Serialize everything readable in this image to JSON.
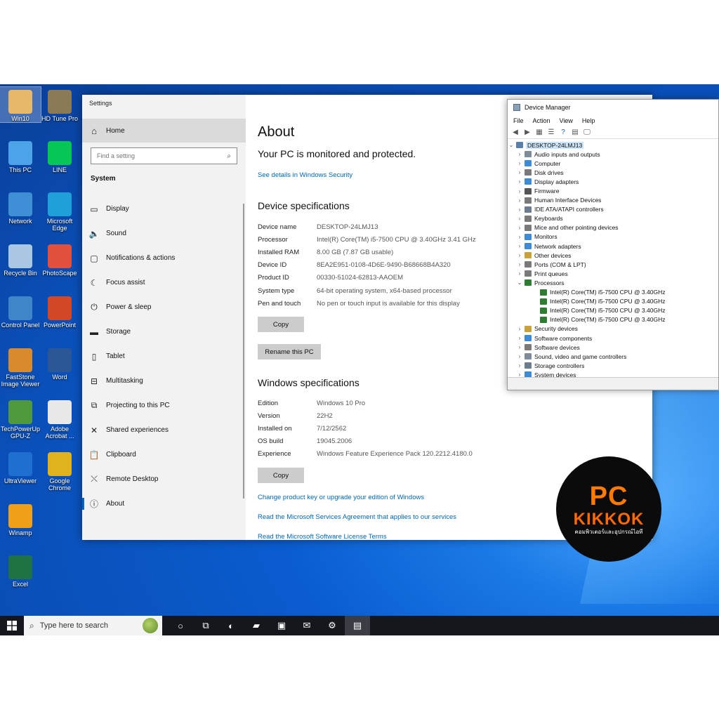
{
  "desktop_icons": [
    {
      "label": "Win10",
      "icon": "user-folder-icon",
      "color": "#e7b86a"
    },
    {
      "label": "HD Tune Pro",
      "icon": "hd-tune-icon",
      "color": "#8a7a55"
    },
    {
      "label": "This PC",
      "icon": "this-pc-icon",
      "color": "#4da3e8"
    },
    {
      "label": "LINE",
      "icon": "line-app-icon",
      "color": "#06c755"
    },
    {
      "label": "Network",
      "icon": "network-icon",
      "color": "#3e8fd6"
    },
    {
      "label": "Microsoft Edge",
      "icon": "edge-icon",
      "color": "#1fa0d8"
    },
    {
      "label": "Recycle Bin",
      "icon": "recycle-bin-icon",
      "color": "#a9c7e3"
    },
    {
      "label": "PhotoScape",
      "icon": "photoscape-icon",
      "color": "#e0503c"
    },
    {
      "label": "Control Panel",
      "icon": "control-panel-icon",
      "color": "#3f86c9"
    },
    {
      "label": "PowerPoint",
      "icon": "powerpoint-icon",
      "color": "#d24726"
    },
    {
      "label": "FastStone Image Viewer",
      "icon": "faststone-eye-icon",
      "color": "#d98a2b"
    },
    {
      "label": "Word",
      "icon": "word-icon",
      "color": "#2b5797"
    },
    {
      "label": "TechPowerUp GPU-Z",
      "icon": "gpu-z-icon",
      "color": "#4f9a3c"
    },
    {
      "label": "Adobe Acrobat ...",
      "icon": "acrobat-icon",
      "color": "#e8e8e8"
    },
    {
      "label": "UltraViewer",
      "icon": "ultraviewer-icon",
      "color": "#1e6fd0"
    },
    {
      "label": "Google Chrome",
      "icon": "chrome-icon",
      "color": "#e0b21d"
    },
    {
      "label": "Winamp",
      "icon": "winamp-icon",
      "color": "#f0a018"
    },
    {
      "label": "Excel",
      "icon": "excel-icon",
      "color": "#1f7244"
    }
  ],
  "settings": {
    "window_title": "Settings",
    "home_label": "Home",
    "search_placeholder": "Find a setting",
    "section_label": "System",
    "nav": [
      {
        "label": "Display",
        "icon": "display-icon",
        "glyph": "▭"
      },
      {
        "label": "Sound",
        "icon": "sound-icon",
        "glyph": "🔈"
      },
      {
        "label": "Notifications & actions",
        "icon": "notifications-icon",
        "glyph": "▢"
      },
      {
        "label": "Focus assist",
        "icon": "focus-assist-icon",
        "glyph": "☾"
      },
      {
        "label": "Power & sleep",
        "icon": "power-icon",
        "glyph": "⏻"
      },
      {
        "label": "Storage",
        "icon": "storage-icon",
        "glyph": "▬"
      },
      {
        "label": "Tablet",
        "icon": "tablet-icon",
        "glyph": "▯"
      },
      {
        "label": "Multitasking",
        "icon": "multitasking-icon",
        "glyph": "⊟"
      },
      {
        "label": "Projecting to this PC",
        "icon": "projecting-icon",
        "glyph": "⧉"
      },
      {
        "label": "Shared experiences",
        "icon": "shared-experiences-icon",
        "glyph": "✕"
      },
      {
        "label": "Clipboard",
        "icon": "clipboard-icon",
        "glyph": "📋"
      },
      {
        "label": "Remote Desktop",
        "icon": "remote-desktop-icon",
        "glyph": "⤬"
      },
      {
        "label": "About",
        "icon": "about-icon",
        "glyph": "ⓘ"
      }
    ],
    "about": {
      "title": "About",
      "protection": "Your PC is monitored and protected.",
      "security_link": "See details in Windows Security",
      "device_spec_heading": "Device specifications",
      "device_specs": [
        {
          "k": "Device name",
          "v": "DESKTOP-24LMJ13"
        },
        {
          "k": "Processor",
          "v": "Intel(R) Core(TM) i5-7500 CPU @ 3.40GHz   3.41 GHz"
        },
        {
          "k": "Installed RAM",
          "v": "8.00 GB (7.87 GB usable)"
        },
        {
          "k": "Device ID",
          "v": "8EA2E951-0108-4D6E-9490-B68668B4A320"
        },
        {
          "k": "Product ID",
          "v": "00330-51024-62813-AAOEM"
        },
        {
          "k": "System type",
          "v": "64-bit operating system, x64-based processor"
        },
        {
          "k": "Pen and touch",
          "v": "No pen or touch input is available for this display"
        }
      ],
      "copy_label": "Copy",
      "rename_label": "Rename this PC",
      "windows_spec_heading": "Windows specifications",
      "windows_specs": [
        {
          "k": "Edition",
          "v": "Windows 10 Pro"
        },
        {
          "k": "Version",
          "v": "22H2"
        },
        {
          "k": "Installed on",
          "v": "7/12/2562"
        },
        {
          "k": "OS build",
          "v": "19045.2006"
        },
        {
          "k": "Experience",
          "v": "Windows Feature Experience Pack 120.2212.4180.0"
        }
      ],
      "copy2_label": "Copy",
      "links": [
        "Change product key or upgrade your edition of Windows",
        "Read the Microsoft Services Agreement that applies to our services",
        "Read the Microsoft Software License Terms"
      ]
    }
  },
  "device_manager": {
    "title": "Device Manager",
    "menu": [
      "File",
      "Action",
      "View",
      "Help"
    ],
    "root": "DESKTOP-24LMJ13",
    "nodes": [
      {
        "label": "Audio inputs and outputs",
        "color": "#7f8c99"
      },
      {
        "label": "Computer",
        "color": "#3d8ad6"
      },
      {
        "label": "Disk drives",
        "color": "#7a7a7a"
      },
      {
        "label": "Display adapters",
        "color": "#3d8ad6"
      },
      {
        "label": "Firmware",
        "color": "#555555"
      },
      {
        "label": "Human Interface Devices",
        "color": "#7a7a7a"
      },
      {
        "label": "IDE ATA/ATAPI controllers",
        "color": "#6b7d8f"
      },
      {
        "label": "Keyboards",
        "color": "#7a7a7a"
      },
      {
        "label": "Mice and other pointing devices",
        "color": "#7a7a7a"
      },
      {
        "label": "Monitors",
        "color": "#3d8ad6"
      },
      {
        "label": "Network adapters",
        "color": "#3d8ad6"
      },
      {
        "label": "Other devices",
        "color": "#c9a33a"
      },
      {
        "label": "Ports (COM & LPT)",
        "color": "#7a7a7a"
      },
      {
        "label": "Print queues",
        "color": "#7a7a7a"
      },
      {
        "label": "Processors",
        "color": "#2e7d32",
        "expanded": true
      }
    ],
    "processors": [
      "Intel(R) Core(TM) i5-7500 CPU @ 3.40GHz",
      "Intel(R) Core(TM) i5-7500 CPU @ 3.40GHz",
      "Intel(R) Core(TM) i5-7500 CPU @ 3.40GHz",
      "Intel(R) Core(TM) i5-7500 CPU @ 3.40GHz"
    ],
    "nodes_after": [
      {
        "label": "Security devices",
        "color": "#c9a33a"
      },
      {
        "label": "Software components",
        "color": "#3d8ad6"
      },
      {
        "label": "Software devices",
        "color": "#7a7a7a"
      },
      {
        "label": "Sound, video and game controllers",
        "color": "#7f8c99"
      },
      {
        "label": "Storage controllers",
        "color": "#6b7d8f"
      },
      {
        "label": "System devices",
        "color": "#3d8ad6"
      }
    ]
  },
  "logo": {
    "pc": "PC",
    "brand": "KIKKOK",
    "tagline": "คอมพิวเตอร์และอุปกรณ์ไอที"
  },
  "taskbar": {
    "search_placeholder": "Type here to search",
    "apps": [
      {
        "icon": "cortana-icon",
        "glyph": "○"
      },
      {
        "icon": "task-view-icon",
        "glyph": "⧉"
      },
      {
        "icon": "edge-icon",
        "glyph": "◐"
      },
      {
        "icon": "file-explorer-icon",
        "glyph": "▰"
      },
      {
        "icon": "store-icon",
        "glyph": "▣"
      },
      {
        "icon": "mail-icon",
        "glyph": "✉"
      },
      {
        "icon": "settings-icon",
        "glyph": "⚙"
      },
      {
        "icon": "device-manager-icon",
        "glyph": "▤",
        "active": true
      }
    ]
  }
}
